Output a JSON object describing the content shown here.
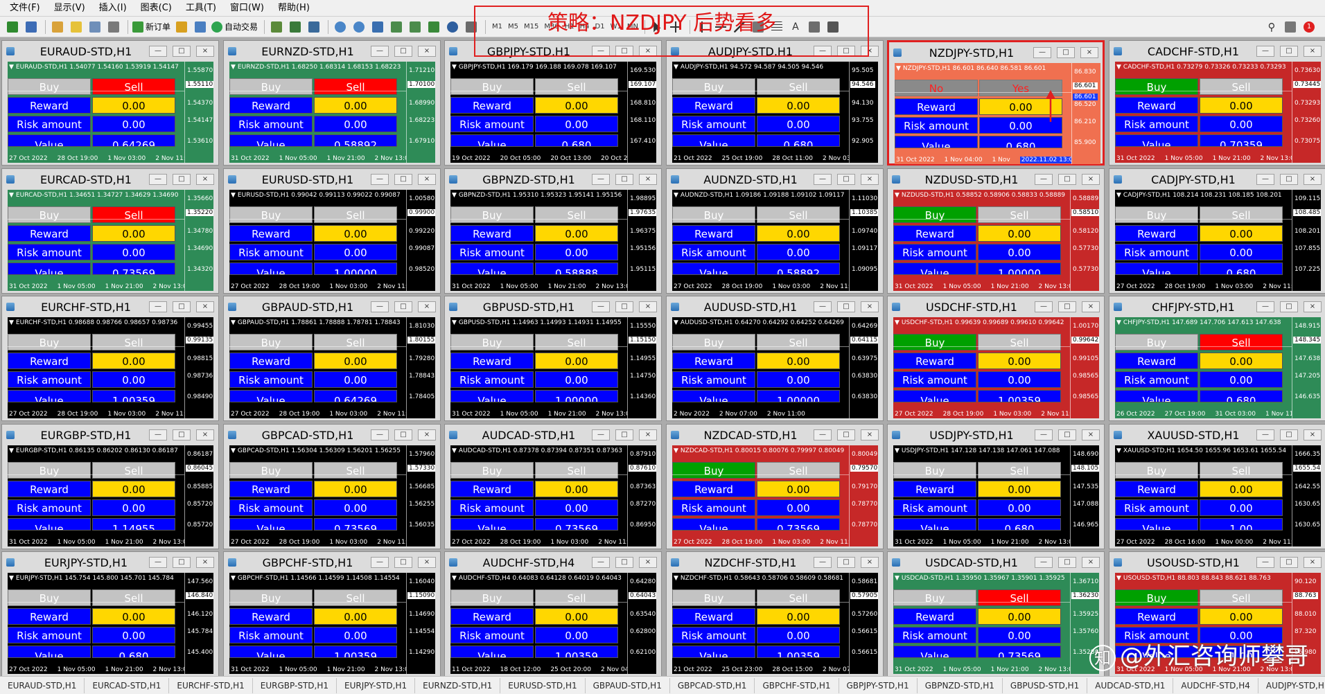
{
  "menu": [
    "文件(F)",
    "显示(V)",
    "插入(I)",
    "图表(C)",
    "工具(T)",
    "窗口(W)",
    "帮助(H)"
  ],
  "toolbar": {
    "new_order": "新订单",
    "auto_trade": "自动交易",
    "timeframes": [
      "M1",
      "M5",
      "M15",
      "M30",
      "H1",
      "H4",
      "D1",
      "W1",
      "MN"
    ],
    "notify_count": "1"
  },
  "annotation": {
    "strategy": "策略：NZDJPY 后势看多",
    "arrow_color": "#e02020"
  },
  "colors": {
    "black_bg": "#000000",
    "green_bg": "#2e8b57",
    "red_bg": "#c62828",
    "orange_bg": "#f07050",
    "price_line": "#ffffff",
    "buy_green": "#00a000",
    "sell_red": "#ff0000",
    "yellow": "#ffd700",
    "blue": "#0000ff"
  },
  "labels": {
    "buy": "Buy",
    "sell": "Sell",
    "reward": "Reward amount",
    "risk": "Risk amount",
    "value": "Value",
    "no": "No",
    "yes": "Yes"
  },
  "charts": [
    {
      "title": "EURAUD-STD,H1",
      "bg": "green",
      "buy": "gray",
      "sell": "red",
      "info": "EURAUD-STD,H1  1.54077 1.54160 1.53919 1.54147",
      "reward": "0.00",
      "risk": "0.00",
      "value": "0.64269",
      "ticks": [
        "1.55870",
        "1.55110",
        "1.54370",
        "1.54147",
        "1.53610"
      ],
      "x": [
        "27 Oct 2022",
        "28 Oct 19:00",
        "1 Nov 03:00",
        "2 Nov 11:00"
      ]
    },
    {
      "title": "EURNZD-STD,H1",
      "bg": "green",
      "buy": "gray",
      "sell": "red",
      "info": "EURNZD-STD,H1  1.68250 1.68314 1.68153 1.68223",
      "reward": "0.00",
      "risk": "0.00",
      "value": "0.58892",
      "ticks": [
        "1.71210",
        "1.70100",
        "1.68990",
        "1.68223",
        "1.67910"
      ],
      "x": [
        "31 Oct 2022",
        "1 Nov 05:00",
        "1 Nov 21:00",
        "2 Nov 13:00"
      ]
    },
    {
      "title": "GBPJPY-STD,H1",
      "bg": "black",
      "buy": "gray",
      "sell": "gray",
      "info": "GBPJPY-STD,H1  169.179 169.188 169.078 169.107",
      "reward": "0.00",
      "risk": "0.00",
      "value": "0.680",
      "ticks": [
        "169.530",
        "169.107",
        "168.810",
        "168.110",
        "167.410"
      ],
      "x": [
        "19 Oct 2022",
        "20 Oct 05:00",
        "20 Oct 13:00",
        "20 Oct 21:00"
      ]
    },
    {
      "title": "AUDJPY-STD,H1",
      "bg": "black",
      "buy": "gray",
      "sell": "gray",
      "info": "AUDJPY-STD,H1  94.572 94.587 94.505 94.546",
      "reward": "0.00",
      "risk": "0.00",
      "value": "0.680",
      "ticks": [
        "95.505",
        "94.546",
        "94.130",
        "93.755",
        "92.905"
      ],
      "x": [
        "21 Oct 2022",
        "25 Oct 19:00",
        "28 Oct 11:00",
        "2 Nov 03:00"
      ]
    },
    {
      "title": "NZDJPY-STD,H1",
      "bg": "orange",
      "buy": "gray",
      "sell": "gray",
      "noyes": true,
      "active": true,
      "info": "NZDJPY-STD,H1  86.601 86.640 86.581 86.601",
      "reward": "0.00",
      "risk": "0.00",
      "value": "0.680",
      "ticks": [
        "86.830",
        "86.601",
        "86.520",
        "86.210",
        "85.900"
      ],
      "x": [
        "31 Oct 2022",
        "1 Nov 04:00",
        "1 Nov",
        "2022.11.02 13:00"
      ]
    },
    {
      "title": "CADCHF-STD,H1",
      "bg": "red",
      "buy": "grn",
      "sell": "gray",
      "info": "CADCHF-STD,H1  0.73279 0.73326 0.73233 0.73293",
      "reward": "0.00",
      "risk": "0.00",
      "value": "0.70359",
      "ticks": [
        "0.73630",
        "0.73445",
        "0.73293",
        "0.73260",
        "0.73075"
      ],
      "x": [
        "31 Oct 2022",
        "1 Nov 05:00",
        "1 Nov 21:00",
        "2 Nov 13:00"
      ]
    },
    {
      "title": "EURCAD-STD,H1",
      "bg": "green",
      "buy": "gray",
      "sell": "red",
      "info": "EURCAD-STD,H1  1.34651 1.34727 1.34629 1.34690",
      "reward": "0.00",
      "risk": "0.00",
      "value": "0.73569",
      "ticks": [
        "1.35660",
        "1.35220",
        "1.34780",
        "1.34690",
        "1.34320"
      ],
      "x": [
        "31 Oct 2022",
        "1 Nov 05:00",
        "1 Nov 21:00",
        "2 Nov 13:00"
      ]
    },
    {
      "title": "EURUSD-STD,H1",
      "bg": "black",
      "buy": "gray",
      "sell": "gray",
      "info": "EURUSD-STD,H1  0.99042 0.99113 0.99022 0.99087",
      "reward": "0.00",
      "risk": "0.00",
      "value": "1.00000",
      "ticks": [
        "1.00580",
        "0.99900",
        "0.99220",
        "0.99087",
        "0.98520"
      ],
      "x": [
        "27 Oct 2022",
        "28 Oct 19:00",
        "1 Nov 03:00",
        "2 Nov 11:00"
      ]
    },
    {
      "title": "GBPNZD-STD,H1",
      "bg": "black",
      "buy": "gray",
      "sell": "gray",
      "info": "GBPNZD-STD,H1  1.95310 1.95323 1.95141 1.95156",
      "reward": "0.00",
      "risk": "0.00",
      "value": "0.58888",
      "ticks": [
        "1.98895",
        "1.97635",
        "1.96375",
        "1.95156",
        "1.95115"
      ],
      "x": [
        "31 Oct 2022",
        "1 Nov 05:00",
        "1 Nov 21:00",
        "2 Nov 13:00"
      ]
    },
    {
      "title": "AUDNZD-STD,H1",
      "bg": "black",
      "buy": "gray",
      "sell": "gray",
      "info": "AUDNZD-STD,H1  1.09186 1.09188 1.09102 1.09117",
      "reward": "0.00",
      "risk": "0.00",
      "value": "0.58892",
      "ticks": [
        "1.11030",
        "1.10385",
        "1.09740",
        "1.09117",
        "1.09095"
      ],
      "x": [
        "27 Oct 2022",
        "28 Oct 19:00",
        "1 Nov 03:00",
        "2 Nov 11:00"
      ]
    },
    {
      "title": "NZDUSD-STD,H1",
      "bg": "red",
      "buy": "grn",
      "sell": "gray",
      "info": "NZDUSD-STD,H1  0.58852 0.58906 0.58833 0.58889",
      "reward": "0.00",
      "risk": "0.00",
      "value": "1.00000",
      "ticks": [
        "0.58889",
        "0.58510",
        "0.58120",
        "0.57730",
        "0.57730"
      ],
      "x": [
        "31 Oct 2022",
        "1 Nov 05:00",
        "1 Nov 21:00",
        "2 Nov 13:00"
      ]
    },
    {
      "title": "CADJPY-STD,H1",
      "bg": "black",
      "buy": "gray",
      "sell": "gray",
      "info": "CADJPY-STD,H1  108.214 108.231 108.185 108.201",
      "reward": "0.00",
      "risk": "0.00",
      "value": "0.680",
      "ticks": [
        "109.115",
        "108.485",
        "108.201",
        "107.855",
        "107.225"
      ],
      "x": [
        "27 Oct 2022",
        "28 Oct 19:00",
        "1 Nov 03:00",
        "2 Nov 11:00"
      ]
    },
    {
      "title": "EURCHF-STD,H1",
      "bg": "black",
      "buy": "gray",
      "sell": "gray",
      "info": "EURCHF-STD,H1  0.98688 0.98766 0.98657 0.98736",
      "reward": "0.00",
      "risk": "0.00",
      "value": "1.00359",
      "ticks": [
        "0.99455",
        "0.99135",
        "0.98815",
        "0.98736",
        "0.98490"
      ],
      "x": [
        "27 Oct 2022",
        "28 Oct 19:00",
        "1 Nov 03:00",
        "2 Nov 11:00"
      ]
    },
    {
      "title": "GBPAUD-STD,H1",
      "bg": "black",
      "buy": "gray",
      "sell": "gray",
      "info": "GBPAUD-STD,H1  1.78861 1.78888 1.78781 1.78843",
      "reward": "0.00",
      "risk": "0.00",
      "value": "0.64269",
      "ticks": [
        "1.81030",
        "1.80155",
        "1.79280",
        "1.78843",
        "1.78405"
      ],
      "x": [
        "27 Oct 2022",
        "28 Oct 19:00",
        "1 Nov 03:00",
        "2 Nov 11:00"
      ]
    },
    {
      "title": "GBPUSD-STD,H1",
      "bg": "black",
      "buy": "gray",
      "sell": "gray",
      "info": "GBPUSD-STD,H1  1.14963 1.14993 1.14931 1.14955",
      "reward": "0.00",
      "risk": "0.00",
      "value": "1.00000",
      "ticks": [
        "1.15550",
        "1.15150",
        "1.14955",
        "1.14750",
        "1.14360"
      ],
      "x": [
        "31 Oct 2022",
        "1 Nov 05:00",
        "1 Nov 21:00",
        "2 Nov 13:00"
      ]
    },
    {
      "title": "AUDUSD-STD,H1",
      "bg": "black",
      "buy": "gray",
      "sell": "gray",
      "info": "AUDUSD-STD,H1  0.64270 0.64292 0.64252 0.64269",
      "reward": "0.00",
      "risk": "0.00",
      "value": "1.00000",
      "ticks": [
        "0.64269",
        "0.64115",
        "0.63975",
        "0.63830",
        "0.63830"
      ],
      "x": [
        "2 Nov 2022",
        "2 Nov 07:00",
        "2 Nov 11:00",
        ""
      ]
    },
    {
      "title": "USDCHF-STD,H1",
      "bg": "red",
      "buy": "grn",
      "sell": "gray",
      "info": "USDCHF-STD,H1  0.99639 0.99689 0.99610 0.99642",
      "reward": "0.00",
      "risk": "0.00",
      "value": "1.00359",
      "ticks": [
        "1.00170",
        "0.99642",
        "0.99105",
        "0.98565",
        "0.98565"
      ],
      "x": [
        "27 Oct 2022",
        "28 Oct 19:00",
        "1 Nov 03:00",
        "2 Nov 11:00"
      ]
    },
    {
      "title": "CHFJPY-STD,H1",
      "bg": "green",
      "buy": "gray",
      "sell": "red",
      "info": "CHFJPY-STD,H1  147.689 147.706 147.613 147.638",
      "reward": "0.00",
      "risk": "0.00",
      "value": "0.680",
      "ticks": [
        "148.915",
        "148.345",
        "147.638",
        "147.205",
        "146.635"
      ],
      "x": [
        "26 Oct 2022",
        "27 Oct 19:00",
        "31 Oct 03:00",
        "1 Nov 11:00"
      ]
    },
    {
      "title": "EURGBP-STD,H1",
      "bg": "black",
      "buy": "gray",
      "sell": "gray",
      "info": "EURGBP-STD,H1  0.86135 0.86202 0.86130 0.86187",
      "reward": "0.00",
      "risk": "0.00",
      "value": "1.14955",
      "ticks": [
        "0.86187",
        "0.86045",
        "0.85885",
        "0.85720",
        "0.85720"
      ],
      "x": [
        "31 Oct 2022",
        "1 Nov 05:00",
        "1 Nov 21:00",
        "2 Nov 13:00"
      ]
    },
    {
      "title": "GBPCAD-STD,H1",
      "bg": "black",
      "buy": "gray",
      "sell": "gray",
      "info": "GBPCAD-STD,H1  1.56304 1.56309 1.56201 1.56255",
      "reward": "0.00",
      "risk": "0.00",
      "value": "0.73569",
      "ticks": [
        "1.57960",
        "1.57330",
        "1.56685",
        "1.56255",
        "1.56035"
      ],
      "x": [
        "27 Oct 2022",
        "28 Oct 19:00",
        "1 Nov 03:00",
        "2 Nov 11:00"
      ]
    },
    {
      "title": "AUDCAD-STD,H1",
      "bg": "black",
      "buy": "gray",
      "sell": "gray",
      "info": "AUDCAD-STD,H1  0.87378 0.87394 0.87351 0.87363",
      "reward": "0.00",
      "risk": "0.00",
      "value": "0.73569",
      "ticks": [
        "0.87910",
        "0.87610",
        "0.87363",
        "0.87270",
        "0.86950"
      ],
      "x": [
        "27 Oct 2022",
        "28 Oct 19:00",
        "1 Nov 03:00",
        "2 Nov 11:00"
      ]
    },
    {
      "title": "NZDCAD-STD,H1",
      "bg": "red",
      "buy": "grn",
      "sell": "gray",
      "info": "NZDCAD-STD,H1  0.80015 0.80076 0.79997 0.80049",
      "reward": "0.00",
      "risk": "0.00",
      "value": "0.73569",
      "ticks": [
        "0.80049",
        "0.79570",
        "0.79170",
        "0.78770",
        "0.78770"
      ],
      "x": [
        "27 Oct 2022",
        "28 Oct 19:00",
        "1 Nov 03:00",
        "2 Nov 11:00"
      ]
    },
    {
      "title": "USDJPY-STD,H1",
      "bg": "black",
      "buy": "gray",
      "sell": "gray",
      "info": "USDJPY-STD,H1  147.128 147.138 147.061 147.088",
      "reward": "0.00",
      "risk": "0.00",
      "value": "0.680",
      "ticks": [
        "148.690",
        "148.105",
        "147.535",
        "147.088",
        "146.965"
      ],
      "x": [
        "31 Oct 2022",
        "1 Nov 05:00",
        "1 Nov 21:00",
        "2 Nov 13:00"
      ]
    },
    {
      "title": "XAUUSD-STD,H1",
      "bg": "black",
      "buy": "gray",
      "sell": "gray",
      "info": "XAUUSD-STD,H1  1654.50 1655.96 1653.61 1655.54",
      "reward": "0.00",
      "risk": "0.00",
      "value": "1.00",
      "ticks": [
        "1666.35",
        "1655.54",
        "1642.55",
        "1630.65",
        "1630.65"
      ],
      "x": [
        "27 Oct 2022",
        "28 Oct 16:00",
        "1 Nov 00:00",
        "2 Nov 11:00"
      ]
    },
    {
      "title": "EURJPY-STD,H1",
      "bg": "black",
      "buy": "gray",
      "sell": "gray",
      "info": "EURJPY-STD,H1  145.754 145.800 145.701 145.784",
      "reward": "0.00",
      "risk": "0.00",
      "value": "0.680",
      "ticks": [
        "147.560",
        "146.840",
        "146.120",
        "145.784",
        "145.400"
      ],
      "x": [
        "27 Oct 2022",
        "1 Nov 05:00",
        "1 Nov 21:00",
        "2 Nov 13:00"
      ]
    },
    {
      "title": "GBPCHF-STD,H1",
      "bg": "black",
      "buy": "gray",
      "sell": "gray",
      "info": "GBPCHF-STD,H1  1.14566 1.14599 1.14508 1.14554",
      "reward": "0.00",
      "risk": "0.00",
      "value": "1.00359",
      "ticks": [
        "1.16040",
        "1.15090",
        "1.14690",
        "1.14554",
        "1.14290"
      ],
      "x": [
        "31 Oct 2022",
        "1 Nov 05:00",
        "1 Nov 21:00",
        "2 Nov 13:00"
      ]
    },
    {
      "title": "AUDCHF-STD,H4",
      "bg": "black",
      "buy": "gray",
      "sell": "gray",
      "info": "AUDCHF-STD,H4  0.64083 0.64128 0.64019 0.64043",
      "reward": "0.00",
      "risk": "0.00",
      "value": "1.00359",
      "ticks": [
        "0.64280",
        "0.64043",
        "0.63540",
        "0.62800",
        "0.62100"
      ],
      "x": [
        "11 Oct 2022",
        "18 Oct 12:00",
        "25 Oct 20:00",
        "2 Nov 04:00"
      ]
    },
    {
      "title": "NZDCHF-STD,H1",
      "bg": "black",
      "buy": "gray",
      "sell": "gray",
      "info": "NZDCHF-STD,H1  0.58643 0.58706 0.58609 0.58681",
      "reward": "0.00",
      "risk": "0.00",
      "value": "1.00359",
      "ticks": [
        "0.58681",
        "0.57905",
        "0.57260",
        "0.56615",
        "0.56615"
      ],
      "x": [
        "21 Oct 2022",
        "25 Oct 23:00",
        "28 Oct 15:00",
        "2 Nov 07:00"
      ]
    },
    {
      "title": "USDCAD-STD,H1",
      "bg": "green",
      "buy": "gray",
      "sell": "red",
      "info": "USDCAD-STD,H1  1.35950 1.35967 1.35901 1.35925",
      "reward": "0.00",
      "risk": "0.00",
      "value": "0.73569",
      "ticks": [
        "1.36710",
        "1.36230",
        "1.35925",
        "1.35760",
        "1.35280"
      ],
      "x": [
        "31 Oct 2022",
        "1 Nov 05:00",
        "1 Nov 21:00",
        "2 Nov 13:00"
      ]
    },
    {
      "title": "USOUSD-STD,H1",
      "bg": "red",
      "buy": "grn",
      "sell": "gray",
      "info": "USOUSD-STD,H1  88.803 88.843 88.621 88.763",
      "reward": "0.00",
      "risk": "0.00",
      "value": "1.00",
      "ticks": [
        "90.120",
        "88.763",
        "88.010",
        "87.320",
        "86.980"
      ],
      "x": [
        "31 Oct 2022",
        "1 Nov 05:00",
        "1 Nov 21:00",
        "2 Nov 13:00"
      ]
    }
  ],
  "tabs": [
    "EURAUD-STD,H1",
    "EURCAD-STD,H1",
    "EURCHF-STD,H1",
    "EURGBP-STD,H1",
    "EURJPY-STD,H1",
    "EURNZD-STD,H1",
    "EURUSD-STD,H1",
    "GBPAUD-STD,H1",
    "GBPCAD-STD,H1",
    "GBPCHF-STD,H1",
    "GBPJPY-STD,H1",
    "GBPNZD-STD,H1",
    "GBPUSD-STD,H1",
    "AUDCAD-STD,H1",
    "AUDCHF-STD,H4",
    "AUDJPY-STD,H1"
  ],
  "watermark": "@外汇咨询师攀哥"
}
